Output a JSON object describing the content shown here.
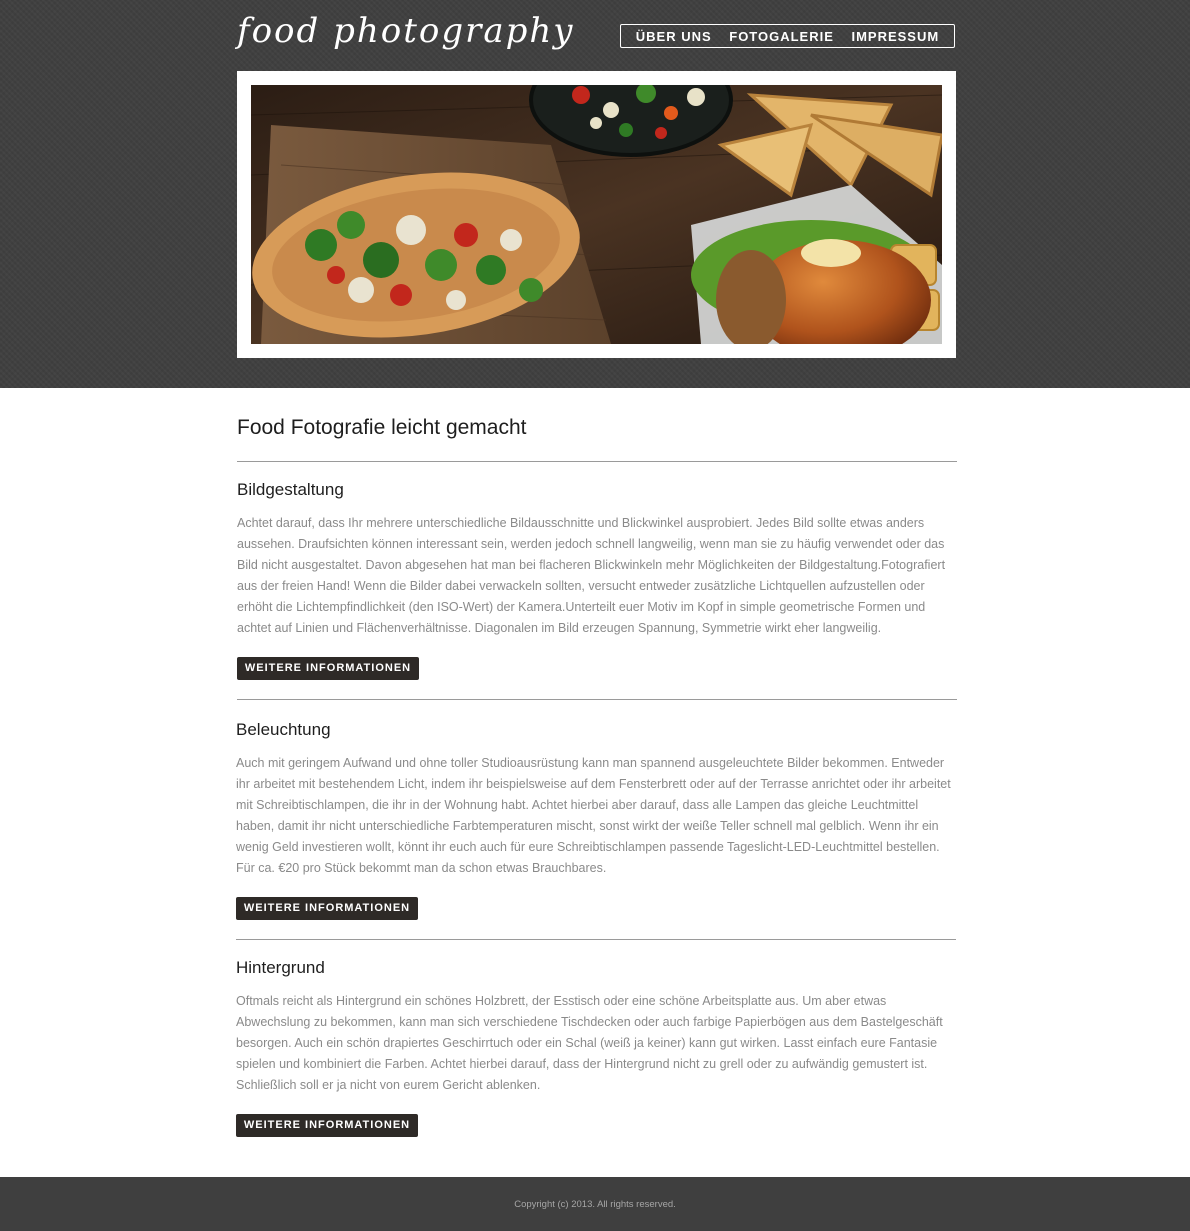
{
  "site": {
    "logo": "food photography",
    "nav": [
      "ÜBER UNS",
      "FOTOGALERIE",
      "IMPRESSUM"
    ]
  },
  "main": {
    "title": "Food Fotografie leicht gemacht",
    "sections": [
      {
        "heading": "Bildgestaltung",
        "text": "Achtet darauf, dass Ihr mehrere unterschiedliche Bildausschnitte und Blickwinkel ausprobiert. Jedes Bild sollte etwas anders aussehen. Draufsichten können interessant sein, werden jedoch schnell langweilig, wenn man sie zu häufig verwendet oder das Bild nicht ausgestaltet. Davon abgesehen hat man bei flacheren Blickwinkeln mehr Möglichkeiten der Bildgestaltung.Fotografiert aus der freien Hand! Wenn die Bilder dabei verwackeln sollten, versucht entweder zusätzliche Lichtquellen aufzustellen oder erhöht die Lichtempfindlichkeit (den ISO-Wert) der Kamera.Unterteilt euer Motiv im Kopf in simple geometrische Formen und achtet auf Linien und Flächenverhältnisse. Diagonalen im Bild erzeugen Spannung, Symmetrie wirkt eher langweilig.",
        "button": "WEITERE INFORMATIONEN"
      },
      {
        "heading": "Beleuchtung",
        "text": "Auch mit geringem Aufwand und ohne toller Studioausrüstung kann man spannend ausgeleuchtete Bilder bekommen. Entweder ihr arbeitet mit bestehendem Licht, indem ihr beispielsweise auf dem Fensterbrett oder auf der Terrasse anrichtet oder ihr arbeitet mit Schreibtischlampen, die ihr in der Wohnung habt. Achtet hierbei aber darauf, dass alle Lampen das gleiche Leuchtmittel haben, damit ihr nicht unterschiedliche Farbtemperaturen mischt, sonst wirkt der weiße Teller schnell mal gelblich. Wenn ihr ein wenig Geld investieren wollt, könnt ihr euch auch für eure Schreibtischlampen passende Tageslicht-LED-Leuchtmittel bestellen. Für ca. €20 pro Stück bekommt man da schon etwas Brauchbares.",
        "button": "WEITERE INFORMATIONEN"
      },
      {
        "heading": "Hintergrund",
        "text": "Oftmals reicht als Hintergrund ein schönes Holzbrett, der Esstisch oder eine schöne Arbeitsplatte aus. Um aber etwas Abwechslung zu bekommen, kann man sich verschiedene Tischdecken oder auch farbige Papierbögen aus dem Bastelgeschäft besorgen. Auch ein schön drapiertes Geschirrtuch oder ein Schal (weiß ja keiner) kann gut wirken. Lasst einfach eure Fantasie spielen und kombiniert die Farben. Achtet hierbei darauf, dass der Hintergrund nicht zu grell oder zu aufwändig gemustert ist. Schließlich soll er ja nicht von eurem Gericht ablenken.",
        "button": "WEITERE INFORMATIONEN"
      }
    ]
  },
  "footer": {
    "copyright": "Copyright (c) 2013. All rights reserved."
  },
  "colors": {
    "header_bg": "#3f3f3f",
    "button_bg": "#2e2a27",
    "body_text": "#8a8a8a",
    "heading_text": "#1e1e1e",
    "rule": "#9a9a9a"
  }
}
